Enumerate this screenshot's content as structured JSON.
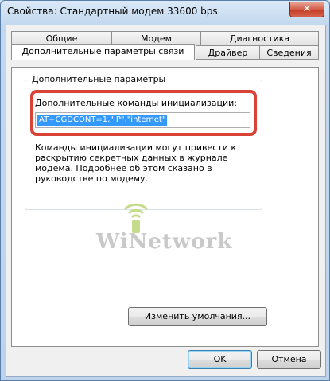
{
  "window": {
    "title": "Свойства: Стандартный модем 33600 bps",
    "close_symbol": "✕"
  },
  "tabs_row1": [
    {
      "label": "Общие"
    },
    {
      "label": "Модем"
    },
    {
      "label": "Диагностика"
    }
  ],
  "tabs_row2": [
    {
      "label": "Дополнительные параметры связи",
      "active": true
    },
    {
      "label": "Драйвер"
    },
    {
      "label": "Сведения"
    }
  ],
  "group": {
    "title": "Дополнительные параметры",
    "label": "Дополнительные команды инициализации:",
    "init_command": "AT+CGDCONT=1,\"IP\",\"internet\"",
    "note": "Команды инициализации могут привести к раскрытию секретных данных в журнале модема. Подробнее об этом сказано в руководстве по модему."
  },
  "watermark": {
    "text": "WiNetwork",
    "color": "#c9c9c9",
    "accent": "#a5c74a"
  },
  "buttons": {
    "change_defaults": "Изменить умолчания...",
    "ok": "OK",
    "cancel": "Отмена"
  },
  "colors": {
    "highlight": "#d94235",
    "selection": "#3399ff"
  }
}
